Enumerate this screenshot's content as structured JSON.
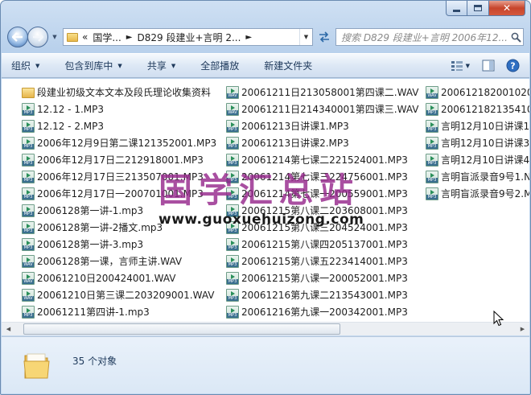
{
  "window": {
    "caption_buttons": {
      "minimize_icon": "minimize-icon",
      "maximize_icon": "maximize-icon",
      "close_icon": "close-icon",
      "close_glyph": "✕"
    }
  },
  "nav": {
    "back_icon": "arrow-left-icon",
    "forward_icon": "arrow-right-icon",
    "address": {
      "overflow": "«",
      "crumbs": [
        "国学...",
        "D829 段建业+言明 2..."
      ],
      "separator": "►"
    },
    "refresh_icon": "refresh-icon",
    "search": {
      "placeholder": "搜索 D829 段建业+言明 2006年12..."
    }
  },
  "toolbar": {
    "organize": "组织",
    "include_in_library": "包含到库中",
    "share": "共享",
    "play_all": "全部播放",
    "new_folder": "新建文件夹"
  },
  "files": {
    "column1": [
      {
        "name": "段建业初级文本文本及段氏理论收集资料",
        "type": "folder"
      },
      {
        "name": "12.12 - 1.MP3",
        "type": "mp3"
      },
      {
        "name": "12.12 - 2.MP3",
        "type": "mp3"
      },
      {
        "name": "2006年12月9日第二课121352001.MP3",
        "type": "mp3"
      },
      {
        "name": "2006年12月17日二212918001.MP3",
        "type": "mp3"
      },
      {
        "name": "2006年12月17日三213507001.MP3",
        "type": "mp3"
      },
      {
        "name": "2006年12月17日一200701001.MP3",
        "type": "mp3"
      },
      {
        "name": "2006128第一讲-1.mp3",
        "type": "mp3"
      },
      {
        "name": "2006128第一讲-2播文.mp3",
        "type": "mp3"
      },
      {
        "name": "2006128第一讲-3.mp3",
        "type": "mp3"
      },
      {
        "name": "2006128第一课，言师主讲.WAV",
        "type": "wav"
      },
      {
        "name": "20061210日200424001.WAV",
        "type": "wav"
      },
      {
        "name": "20061210日第三课二203209001.WAV",
        "type": "wav"
      },
      {
        "name": "20061211第四讲-1.mp3",
        "type": "mp3"
      }
    ],
    "column2": [
      {
        "name": "20061211日213058001第四课二.WAV",
        "type": "wav"
      },
      {
        "name": "20061211日214340001第四课三.WAV",
        "type": "wav"
      },
      {
        "name": "20061213日讲课1.MP3",
        "type": "mp3"
      },
      {
        "name": "20061213日讲课2.MP3",
        "type": "mp3"
      },
      {
        "name": "20061214第七课二221524001.MP3",
        "type": "mp3"
      },
      {
        "name": "20061214第七课三224756001.MP3",
        "type": "mp3"
      },
      {
        "name": "20061214第七课一200559001.MP3",
        "type": "mp3"
      },
      {
        "name": "20061215第八课二203608001.MP3",
        "type": "mp3"
      },
      {
        "name": "20061215第八课三204524001.MP3",
        "type": "mp3"
      },
      {
        "name": "20061215第八课四205137001.MP3",
        "type": "mp3"
      },
      {
        "name": "20061215第八课五223414001.MP3",
        "type": "mp3"
      },
      {
        "name": "20061215第八课一200052001.MP3",
        "type": "mp3"
      },
      {
        "name": "20061216第九课二213543001.MP3",
        "type": "mp3"
      },
      {
        "name": "20061216第九课一200342001.MP3",
        "type": "mp3"
      }
    ],
    "column3": [
      {
        "name": "2006121820010200",
        "type": "wav"
      },
      {
        "name": "200612182135410",
        "type": "mp3"
      },
      {
        "name": "言明12月10日讲课1",
        "type": "mp3"
      },
      {
        "name": "言明12月10日讲课3",
        "type": "mp3"
      },
      {
        "name": "言明12月10日讲课4",
        "type": "mp3"
      },
      {
        "name": "言明盲派录音9号1.N",
        "type": "mp3"
      },
      {
        "name": "言明盲派录音9号2.M",
        "type": "mp3"
      }
    ]
  },
  "watermark": {
    "title": "国学汇总站",
    "url": "www.guoxuehuizong.com"
  },
  "status": {
    "count": "35 个对象"
  }
}
